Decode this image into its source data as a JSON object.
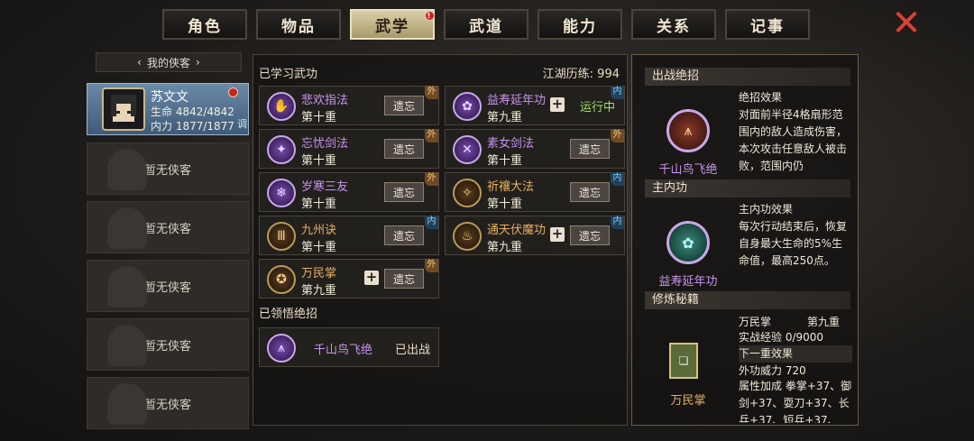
{
  "tabs": [
    {
      "label": "角色"
    },
    {
      "label": "物品"
    },
    {
      "label": "武学",
      "active": true,
      "badge": "!"
    },
    {
      "label": "武道"
    },
    {
      "label": "能力"
    },
    {
      "label": "关系"
    },
    {
      "label": "记事"
    }
  ],
  "close_icon": "close-icon",
  "left": {
    "header": "我的侠客",
    "hero": {
      "name": "苏文文",
      "hp": "生命 4842/4842",
      "mp": "内力 1877/1877",
      "adjust": "调",
      "badge": "!"
    },
    "empty_label": "暂无侠客",
    "empty_count": 5
  },
  "mid": {
    "learned_title": "已学习武功",
    "experience": "江湖历练: 994",
    "forget_label": "遗忘",
    "skills": [
      {
        "name": "悲欢指法",
        "level": "第十重",
        "color": "purple",
        "tag": "外",
        "action": "forget"
      },
      {
        "name": "益寿延年功",
        "level": "第九重",
        "color": "purple",
        "tag": "内",
        "action": "running",
        "status": "运行中",
        "plus": true
      },
      {
        "name": "忘忧剑法",
        "level": "第十重",
        "color": "purple",
        "tag": "外",
        "action": "forget"
      },
      {
        "name": "素女剑法",
        "level": "第十重",
        "color": "purple",
        "tag": "外",
        "action": "forget"
      },
      {
        "name": "岁寒三友",
        "level": "第十重",
        "color": "purple",
        "tag": "外",
        "action": "forget"
      },
      {
        "name": "祈禳大法",
        "level": "第十重",
        "color": "orange",
        "tag": "内",
        "action": "forget"
      },
      {
        "name": "九州诀",
        "level": "第十重",
        "color": "orange",
        "tag": "内",
        "action": "forget"
      },
      {
        "name": "通天伏魔功",
        "level": "第九重",
        "color": "orange",
        "tag": "内",
        "action": "forget",
        "plus": true
      },
      {
        "name": "万民掌",
        "level": "第九重",
        "color": "orange",
        "tag": "外",
        "action": "forget",
        "plus": true
      }
    ],
    "ultimate_title": "已领悟绝招",
    "ultimate": {
      "name": "千山鸟飞绝",
      "status": "已出战"
    }
  },
  "right": {
    "battle_title": "出战绝招",
    "battle_skill": "千山鸟飞绝",
    "battle_effect_title": "绝招效果",
    "battle_effect": "对面前半径4格扇形范围内的敌人造成伤害，本次攻击任意敌人被击败，范围内仍",
    "inner_title": "主内功",
    "inner_skill": "益寿延年功",
    "inner_effect_title": "主内功效果",
    "inner_effect": "每次行动结束后，恢复自身最大生命的5%生命值，最高250点。",
    "manual_title": "修炼秘籍",
    "manual_skill": "万民掌",
    "manual_level": "第九重",
    "manual_exp": "实战经验 0/9000",
    "next_effect": "下一重效果",
    "manual_power": "外功威力 720",
    "manual_attr": "属性加成 拳掌+37、御剑+37、耍刀+37、长兵+37、短兵+37、"
  }
}
